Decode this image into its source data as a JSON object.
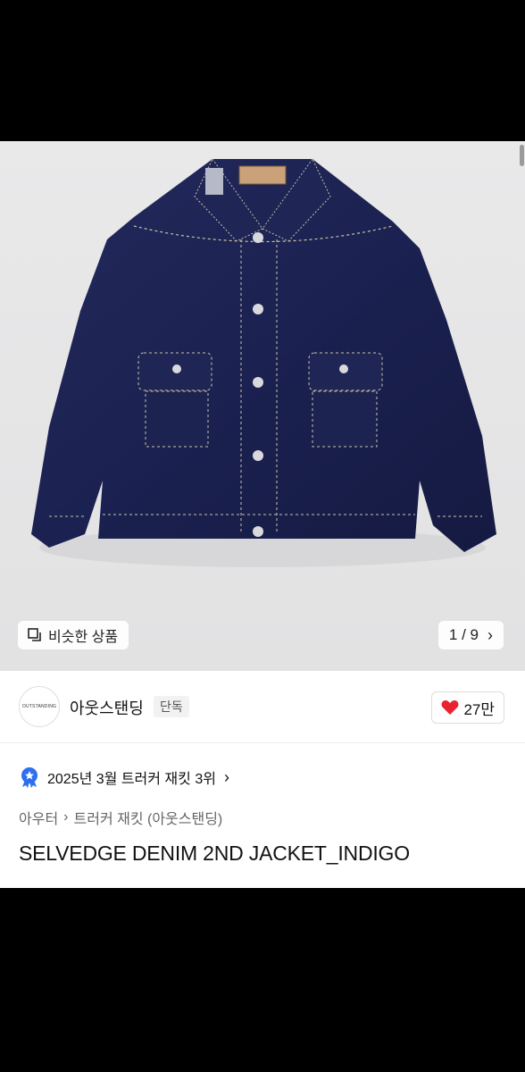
{
  "gallery": {
    "similar_label": "비슷한 상품",
    "counter": "1 / 9"
  },
  "brand": {
    "logo_text": "OUTSTANDING",
    "name": "아웃스탠딩",
    "badge": "단독",
    "like_count": "27만"
  },
  "ranking": {
    "text": "2025년 3월 트러커 재킷 3위"
  },
  "breadcrumb": {
    "category": "아우터",
    "subcategory": "트러커 재킷 (아웃스탠딩)"
  },
  "product": {
    "title": "SELVEDGE DENIM 2ND JACKET_INDIGO"
  },
  "colors": {
    "heart": "#e8242f",
    "denim": "#1c2350",
    "badge_blue": "#2d6ff0"
  }
}
